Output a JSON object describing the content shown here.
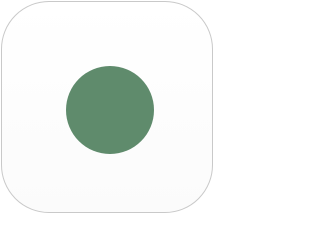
{
  "icon": {
    "name": "app-icon",
    "border_color": "#c9c9c9",
    "background_color": "#ffffff",
    "dot_color": "#5f8b6c",
    "dot_icon": "circle-icon"
  }
}
